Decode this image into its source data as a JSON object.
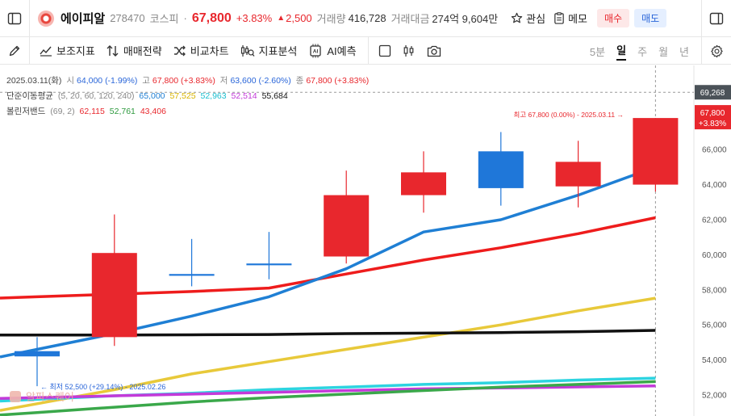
{
  "header": {
    "stock_name": "에이피알",
    "code": "278470",
    "market": "코스피",
    "price": "67,800",
    "change_pct": "+3.83%",
    "change_amt": "2,500",
    "volume_label": "거래량",
    "volume": "416,728",
    "value_label": "거래대금",
    "value": "274억 9,604만",
    "watch_label": "관심",
    "memo_label": "메모",
    "buy_label": "매수",
    "sell_label": "매도"
  },
  "toolbar": {
    "tools": [
      "보조지표",
      "매매전략",
      "비교차트",
      "지표분석",
      "AI예측"
    ],
    "periods": [
      "5분",
      "일",
      "주",
      "월",
      "년"
    ],
    "active_period": "일"
  },
  "info": {
    "date": "2025.03.11(화)",
    "open_label": "시",
    "open": "64,000 (-1.99%)",
    "high_label": "고",
    "high": "67,800 (+3.83%)",
    "low_label": "저",
    "low": "63,600 (-2.60%)",
    "close_label": "종",
    "close": "67,800 (+3.83%)",
    "ma_label": "단순이동평균",
    "ma_params": "(5, 20, 60, 120, 240)",
    "ma_values": [
      "65,000",
      "57,525",
      "52,963",
      "52,514",
      "55,684"
    ],
    "bb_label": "볼린저밴드",
    "bb_params": "(69, 2)",
    "bb_values": [
      "62,115",
      "52,761",
      "43,406"
    ]
  },
  "annotations": {
    "high": "최고 67,800 (0.00%) - 2025.03.11",
    "low": "최저 52,500 (+29.14%) - 2025.02.26",
    "crosshair_price": "69,268",
    "last_price": "67,800",
    "last_change": "+3.83%",
    "watermark": "알파스퀘어"
  },
  "colors": {
    "up": "#e8272d",
    "down": "#1f77d9",
    "ma5": "#1f7fd4",
    "ma20": "#e8c93a",
    "ma60": "#2dd4e0",
    "ma120": "#c33ad9",
    "ma240": "#111111",
    "bb_upper": "#ee1c1c",
    "bb_mid": "#3aa84a",
    "bb_lower": "#1f7fd4"
  },
  "chart_data": {
    "type": "candlestick",
    "ylim": [
      50800,
      70800
    ],
    "yticks": [
      "52,000",
      "54,000",
      "56,000",
      "58,000",
      "60,000",
      "62,000",
      "64,000",
      "66,000"
    ],
    "ytick_values": [
      52000,
      54000,
      56000,
      58000,
      60000,
      62000,
      64000,
      66000
    ],
    "candles": [
      {
        "open": 54500,
        "high": 55300,
        "low": 52500,
        "close": 54200
      },
      {
        "open": 55300,
        "high": 62300,
        "low": 54800,
        "close": 60100
      },
      {
        "open": 58900,
        "high": 60900,
        "low": 58200,
        "close": 58800
      },
      {
        "open": 59500,
        "high": 61300,
        "low": 58600,
        "close": 59400
      },
      {
        "open": 59900,
        "high": 64800,
        "low": 59500,
        "close": 63400
      },
      {
        "open": 63400,
        "high": 65900,
        "low": 62400,
        "close": 64700
      },
      {
        "open": 65900,
        "high": 67000,
        "low": 62800,
        "close": 63800
      },
      {
        "open": 63900,
        "high": 66500,
        "low": 62700,
        "close": 65300
      },
      {
        "open": 64000,
        "high": 67800,
        "low": 63600,
        "close": 67800
      }
    ],
    "series": [
      {
        "name": "5",
        "color": "#1f7fd4",
        "values": [
          54600,
          55500,
          56500,
          57600,
          59200,
          61300,
          62000,
          63400,
          65000
        ]
      },
      {
        "name": "20",
        "color": "#e8c93a",
        "values": [
          51500,
          52300,
          53200,
          53900,
          54600,
          55300,
          56000,
          56800,
          57525
        ]
      },
      {
        "name": "60",
        "color": "#2dd4e0",
        "values": [
          51750,
          51950,
          52100,
          52300,
          52450,
          52600,
          52700,
          52850,
          52963
        ]
      },
      {
        "name": "120",
        "color": "#c33ad9",
        "values": [
          51850,
          51950,
          52050,
          52150,
          52250,
          52350,
          52400,
          52460,
          52514
        ]
      },
      {
        "name": "240",
        "color": "#111111",
        "values": [
          55420,
          55420,
          55430,
          55450,
          55500,
          55530,
          55560,
          55610,
          55684
        ]
      },
      {
        "name": "bb_upper",
        "color": "#ee1c1c",
        "values": [
          57600,
          57750,
          57900,
          58100,
          58900,
          59700,
          60400,
          61200,
          62115
        ]
      },
      {
        "name": "bb_mid",
        "color": "#3aa84a",
        "values": [
          51000,
          51300,
          51600,
          51850,
          52050,
          52250,
          52450,
          52600,
          52761
        ]
      }
    ]
  }
}
